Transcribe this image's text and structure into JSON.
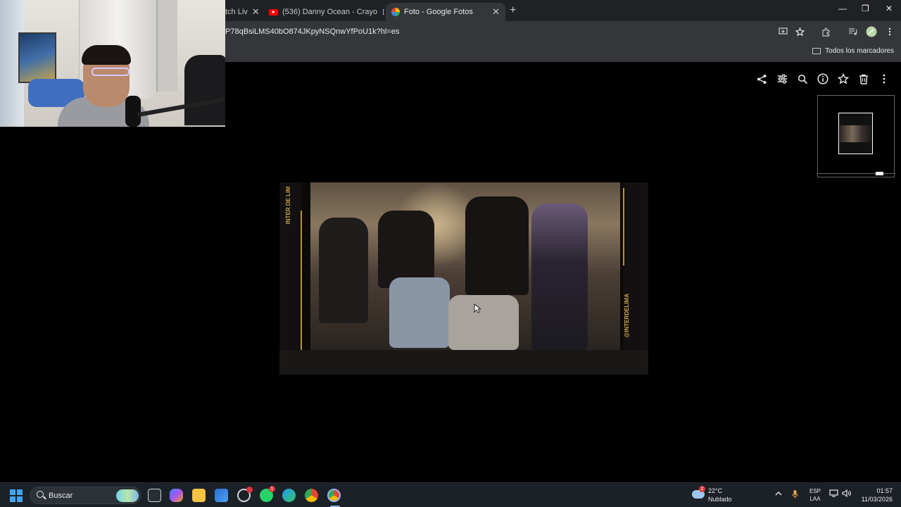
{
  "browser": {
    "tabs": [
      {
        "label": "tch Liv",
        "active": false
      },
      {
        "label": "(536) Danny Ocean - Crayo",
        "active": false
      },
      {
        "label": "Foto - Google Fotos",
        "active": true
      }
    ],
    "close_glyph": "✕",
    "new_tab_glyph": "+",
    "url": "P78qBsiLMS40bO874JKpyNSQnwYfPoU1k?hl=es",
    "bookmarks_all_label": "Todos los marcadores",
    "window_controls": [
      "—",
      "❐",
      "✕"
    ]
  },
  "photo_viewer": {
    "actions": [
      {
        "name": "share-icon",
        "glyph": "⋖"
      },
      {
        "name": "edit-icon",
        "glyph": "☰"
      },
      {
        "name": "zoom-icon",
        "glyph": "⌕"
      },
      {
        "name": "info-icon",
        "glyph": "ⓘ"
      },
      {
        "name": "favorite-icon",
        "glyph": "☆"
      },
      {
        "name": "delete-icon",
        "glyph": "🗑"
      },
      {
        "name": "more-icon",
        "glyph": "⋮"
      }
    ],
    "photo_watermark_left": "INTER DE LIM",
    "photo_watermark_right": "@INTERDELIMA"
  },
  "taskbar": {
    "search_label": "Buscar",
    "weather": {
      "temp": "22°C",
      "condition": "Nublado",
      "badge": "2"
    },
    "whatsapp_badge": "1",
    "language": {
      "line1": "ESP",
      "line2": "LAA"
    },
    "clock": {
      "time": "01:57",
      "date": "11/03/2026"
    },
    "colors": {
      "accent": "#8ab4f8",
      "badge": "#e0343a"
    }
  }
}
